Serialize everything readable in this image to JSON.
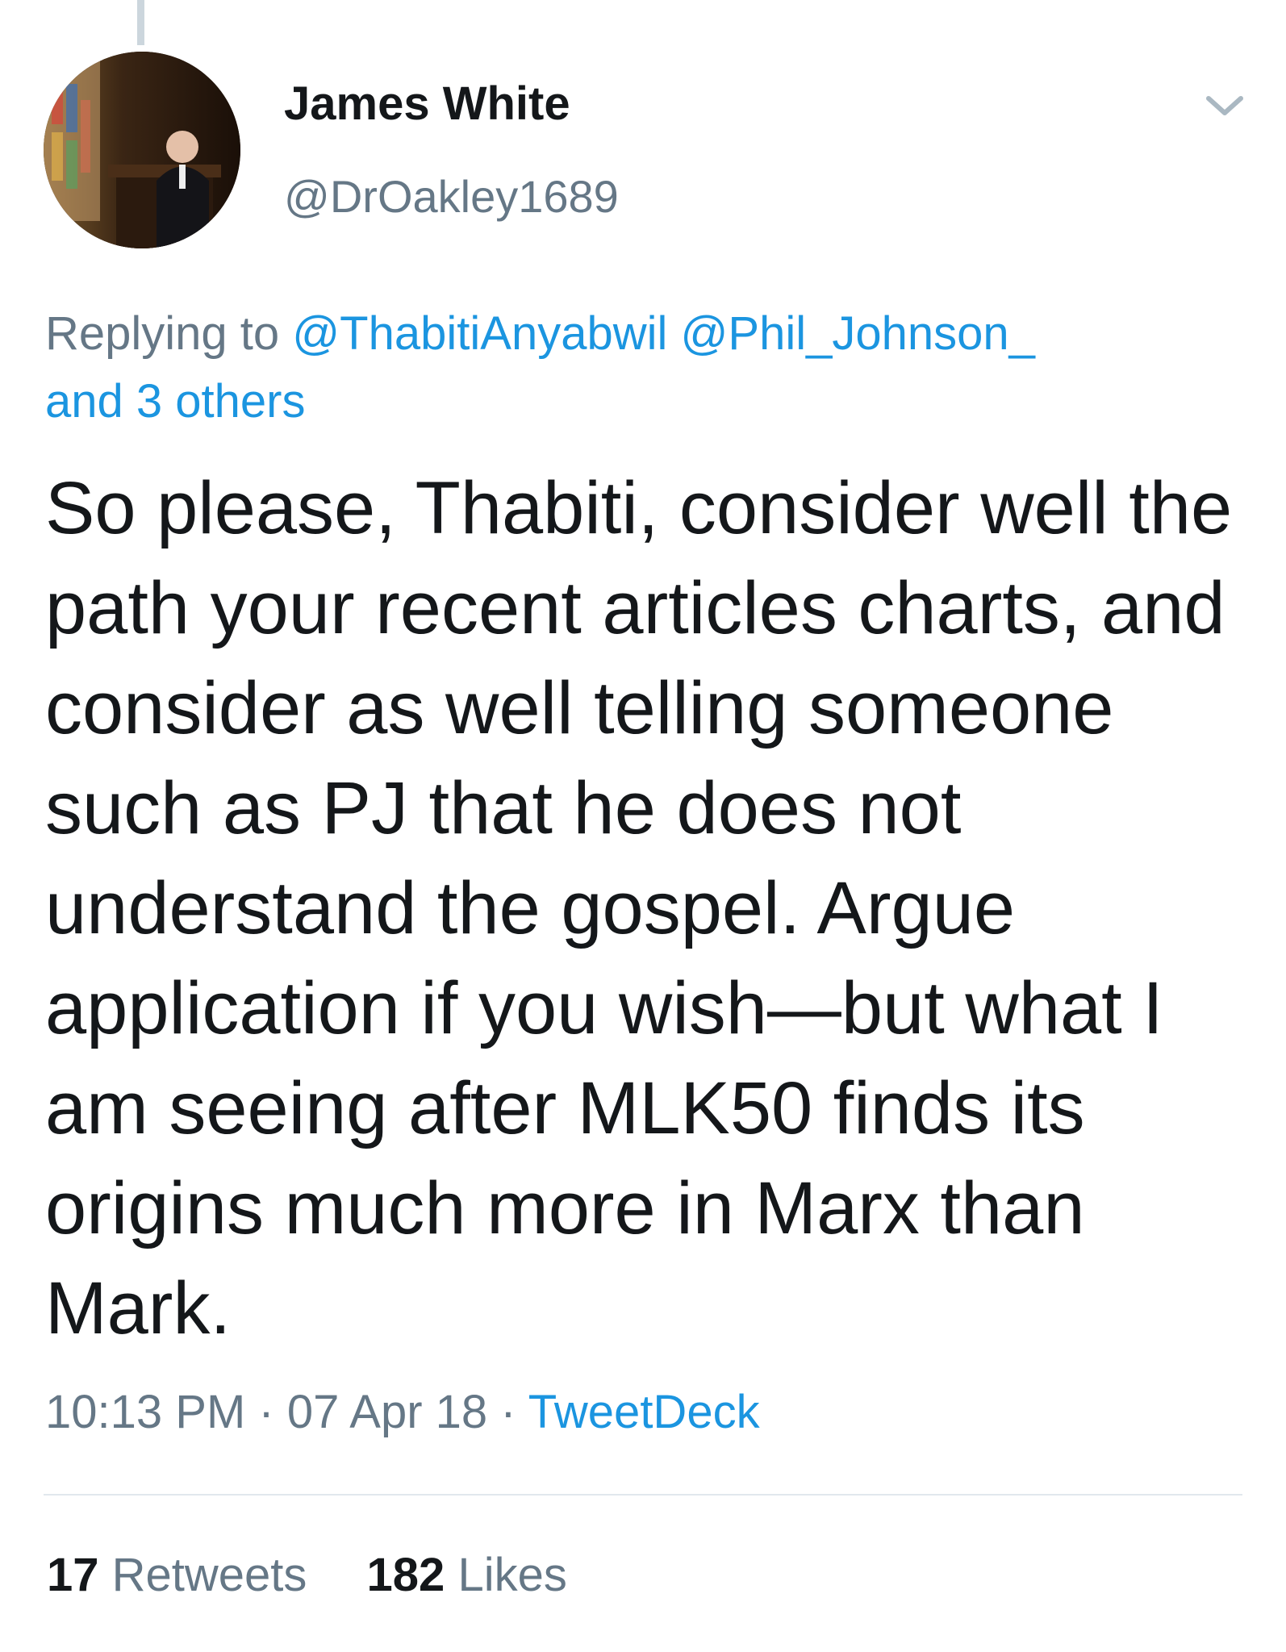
{
  "tweet": {
    "author": {
      "name": "James White",
      "handle": "@DrOakley1689",
      "avatar_icon": "avatar-photo"
    },
    "menu_icon": "chevron-down-icon",
    "replying": {
      "prefix": "Replying to",
      "mention_1": "@ThabitiAnyabwil",
      "mention_2": "@Phil_Johnson_",
      "others": "and 3 others"
    },
    "text": "So please, Thabiti, consider well the path your recent articles charts, and consider as well telling someone such as PJ that he does not understand the gospel. Argue application if you wish—but what I am seeing after MLK50 finds its origins much more in Marx than Mark.",
    "time": "10:13 PM",
    "date": "07 Apr 18",
    "separator": "·",
    "source": "TweetDeck",
    "retweets_count": "17",
    "retweets_label": "Retweets",
    "likes_count": "182",
    "likes_label": "Likes"
  },
  "colors": {
    "text": "#14171a",
    "secondary": "#657786",
    "link": "#1b95e0",
    "divider": "#e1e8ed"
  }
}
